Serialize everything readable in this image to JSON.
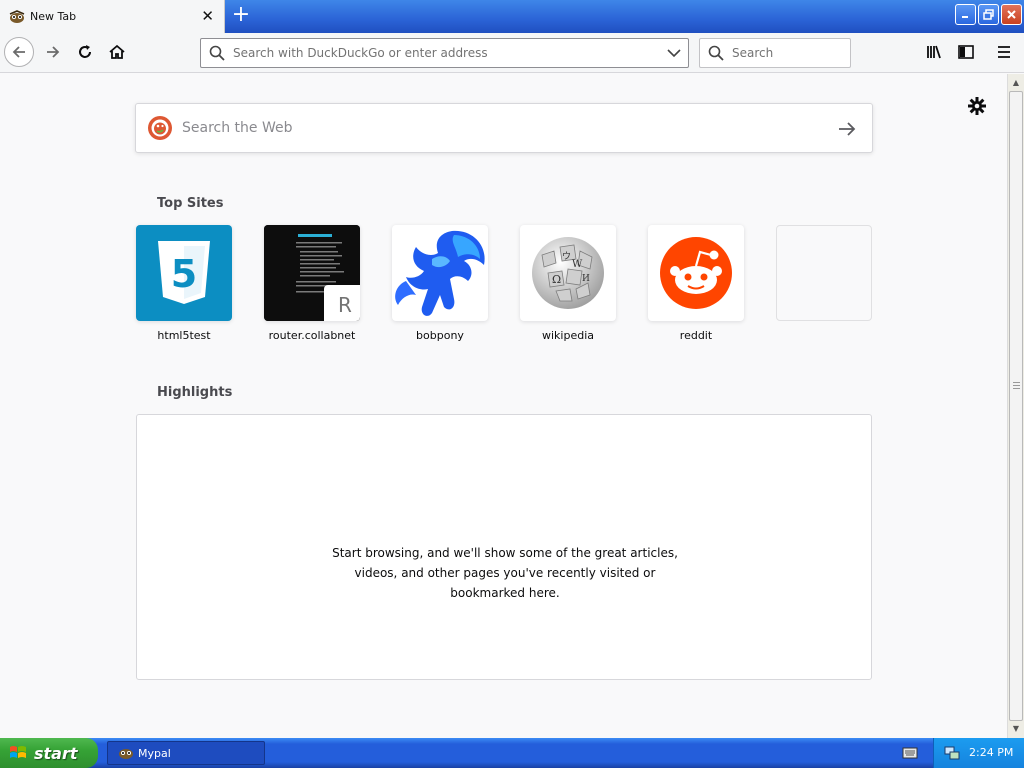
{
  "window": {
    "tab_title": "New Tab",
    "new_tab_label": "+"
  },
  "navbar": {
    "url_placeholder": "Search with DuckDuckGo or enter address",
    "search_placeholder": "Search"
  },
  "content": {
    "web_search_placeholder": "Search the Web",
    "top_sites_title": "Top Sites",
    "top_sites": [
      {
        "label": "html5test",
        "icon": "html5-logo"
      },
      {
        "label": "router.collabnet",
        "icon": "screenshot-thumbnail",
        "badge": "R"
      },
      {
        "label": "bobpony",
        "icon": "blue-pony-logo"
      },
      {
        "label": "wikipedia",
        "icon": "wikipedia-globe"
      },
      {
        "label": "reddit",
        "icon": "reddit-alien"
      },
      {
        "label": "",
        "icon": "empty-slot"
      }
    ],
    "highlights_title": "Highlights",
    "highlights_empty_message": "Start browsing, and we'll show some of the great articles, videos, and other pages you've recently visited or bookmarked here."
  },
  "taskbar": {
    "start_label": "start",
    "task_label": "Mypal",
    "clock": "2:24 PM"
  },
  "colors": {
    "accent": "#0060df",
    "html5": "#0c8ec2",
    "reddit": "#ff4500",
    "xp_blue": "#245edb",
    "xp_green": "#36a336"
  }
}
